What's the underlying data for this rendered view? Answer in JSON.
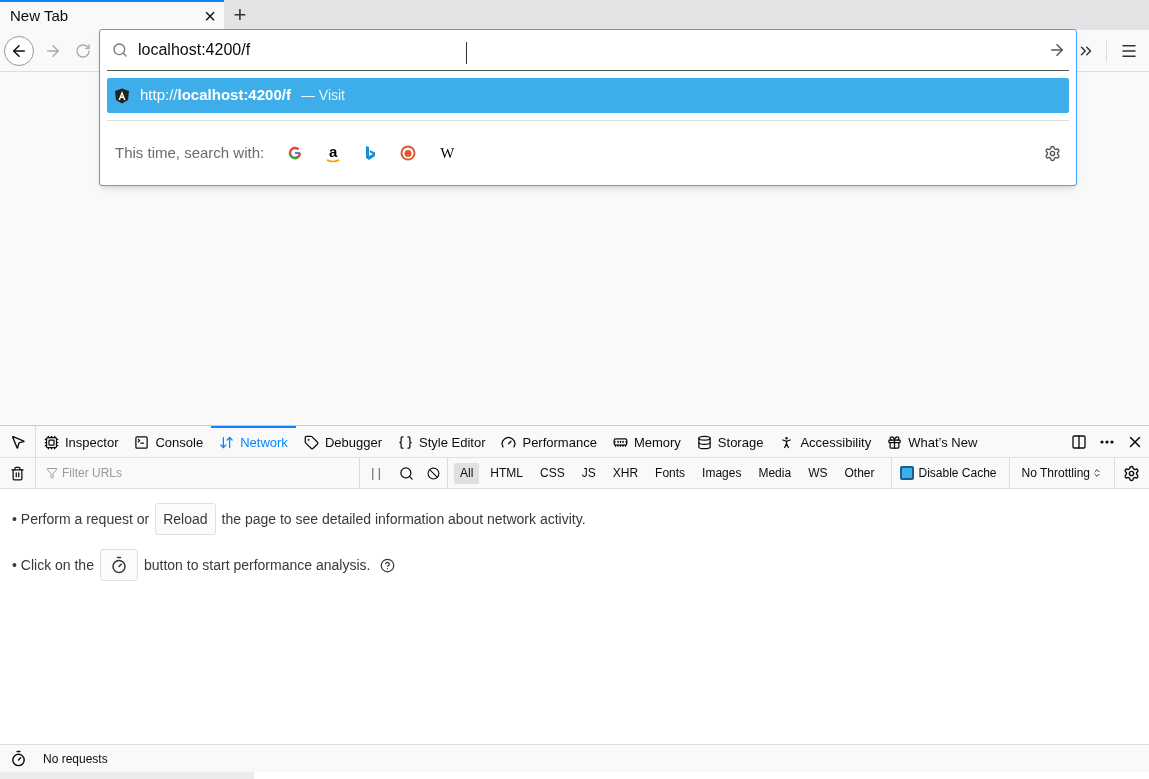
{
  "tab": {
    "title": "New Tab",
    "close": "×",
    "new": "+"
  },
  "urlbar": {
    "value": "localhost:4200/f"
  },
  "suggestion": {
    "prefix": "http://",
    "host": "localhost:4200/f",
    "separator": "—",
    "action": "Visit",
    "selected": true
  },
  "search_with": {
    "label": "This time, search with:",
    "engines": [
      {
        "kind": "google"
      },
      {
        "kind": "amazon",
        "glyph": "a"
      },
      {
        "kind": "bing"
      },
      {
        "kind": "duckduckgo"
      },
      {
        "kind": "wikipedia",
        "glyph": "W"
      }
    ]
  },
  "devtools": {
    "tabs": [
      {
        "label": "Inspector",
        "kind": "inspector",
        "selected": false
      },
      {
        "label": "Console",
        "kind": "console",
        "selected": false
      },
      {
        "label": "Network",
        "kind": "network",
        "selected": true
      },
      {
        "label": "Debugger",
        "kind": "debugger",
        "selected": false
      },
      {
        "label": "Style Editor",
        "kind": "style",
        "selected": false
      },
      {
        "label": "Performance",
        "kind": "performance",
        "selected": false
      },
      {
        "label": "Memory",
        "kind": "memory",
        "selected": false
      },
      {
        "label": "Storage",
        "kind": "storage",
        "selected": false
      },
      {
        "label": "Accessibility",
        "kind": "accessibility",
        "selected": false
      },
      {
        "label": "What’s New",
        "kind": "gift",
        "selected": false
      }
    ],
    "filter": {
      "placeholder": "Filter URLs"
    },
    "pause": "| |",
    "types": [
      {
        "label": "All",
        "selected": true
      },
      {
        "label": "HTML",
        "selected": false
      },
      {
        "label": "CSS",
        "selected": false
      },
      {
        "label": "JS",
        "selected": false
      },
      {
        "label": "XHR",
        "selected": false
      },
      {
        "label": "Fonts",
        "selected": false
      },
      {
        "label": "Images",
        "selected": false
      },
      {
        "label": "Media",
        "selected": false
      },
      {
        "label": "WS",
        "selected": false
      },
      {
        "label": "Other",
        "selected": false
      }
    ],
    "disable_cache": {
      "label": "Disable Cache",
      "checked": true
    },
    "throttling": {
      "value": "No Throttling"
    },
    "messages": [
      {
        "bullet": "•",
        "before": "Perform a request or",
        "button": {
          "kind": "text",
          "label": "Reload"
        },
        "after": "the page to see detailed information about network activity.",
        "help": false
      },
      {
        "bullet": "•",
        "before": "Click on the",
        "button": {
          "kind": "stopwatch"
        },
        "after": "button to start performance analysis.",
        "help": true
      }
    ],
    "status": {
      "text": "No requests"
    }
  }
}
